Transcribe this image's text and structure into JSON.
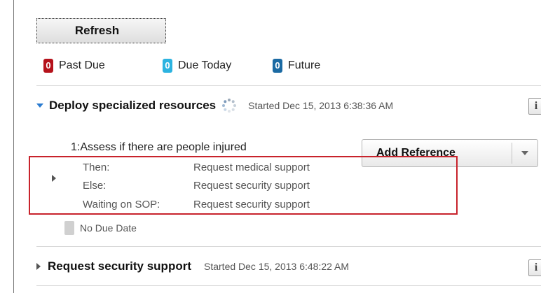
{
  "toolbar": {
    "refresh_label": "Refresh"
  },
  "status_filters": [
    {
      "count": "0",
      "label": "Past Due",
      "color": "#b5121b"
    },
    {
      "count": "0",
      "label": "Due Today",
      "color": "#2cb3e0"
    },
    {
      "count": "0",
      "label": "Future",
      "color": "#1b6aa3"
    }
  ],
  "tasks": [
    {
      "title": "Deploy specialized resources",
      "started": "Started Dec 15, 2013 6:38:36 AM",
      "expanded": true,
      "info_icon": "i",
      "step": {
        "title": "1:Assess if there are people injured",
        "add_reference_label": "Add Reference",
        "details": [
          {
            "key": "Then:",
            "value": "Request medical support"
          },
          {
            "key": "Else:",
            "value": "Request security support"
          },
          {
            "key": "Waiting on SOP:",
            "value": "Request security support"
          }
        ],
        "due": "No Due Date"
      }
    },
    {
      "title": "Request security support",
      "started": "Started Dec 15, 2013 6:48:22 AM",
      "expanded": false,
      "info_icon": "i"
    }
  ]
}
